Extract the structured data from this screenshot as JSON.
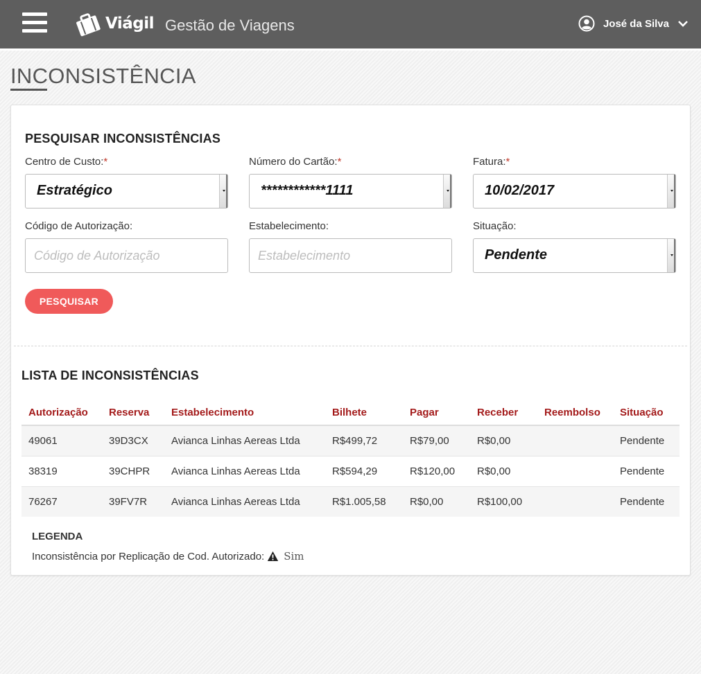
{
  "header": {
    "brand": "Viágil",
    "app_title": "Gestão de Viagens",
    "user_name": "José da Silva",
    "icons": {
      "menu": "hamburger-icon",
      "logo": "suitcase-icon",
      "user": "user-circle-icon",
      "caret": "chevron-down-icon"
    }
  },
  "page": {
    "title": "INCONSISTÊNCIA"
  },
  "search": {
    "title": "PESQUISAR INCONSISTÊNCIAS",
    "required_mark": "*",
    "cost_center": {
      "label": "Centro de Custo:",
      "value": "Estratégico"
    },
    "card_number": {
      "label": "Número do Cartão:",
      "value": "************1111"
    },
    "invoice": {
      "label": "Fatura:",
      "value": "10/02/2017"
    },
    "auth_code": {
      "label": "Código de Autorização:",
      "placeholder": "Código de Autorização"
    },
    "establishment": {
      "label": "Estabelecimento:",
      "placeholder": "Estabelecimento"
    },
    "status": {
      "label": "Situação:",
      "value": "Pendente"
    },
    "button_label": "PESQUISAR"
  },
  "list": {
    "title": "LISTA DE INCONSISTÊNCIAS",
    "columns": [
      "Autorização",
      "Reserva",
      "Estabelecimento",
      "Bilhete",
      "Pagar",
      "Receber",
      "Reembolso",
      "Situação"
    ],
    "rows": [
      [
        "49061",
        "39D3CX",
        "Avianca Linhas Aereas Ltda",
        "R$499,72",
        "R$79,00",
        "R$0,00",
        "",
        "Pendente"
      ],
      [
        "38319",
        "39CHPR",
        "Avianca Linhas Aereas Ltda",
        "R$594,29",
        "R$120,00",
        "R$0,00",
        "",
        "Pendente"
      ],
      [
        "76267",
        "39FV7R",
        "Avianca Linhas Aereas Ltda",
        "R$1.005,58",
        "R$0,00",
        "R$100,00",
        "",
        "Pendente"
      ]
    ]
  },
  "legend": {
    "title": "LEGENDA",
    "text": "Inconsistência por Replicação de Cod. Autorizado:",
    "icon": "warning-icon",
    "value": "Sim"
  },
  "colors": {
    "topbar": "#5e5e5e",
    "accent": "#f05a5a",
    "table_header": "#a31a1a"
  }
}
